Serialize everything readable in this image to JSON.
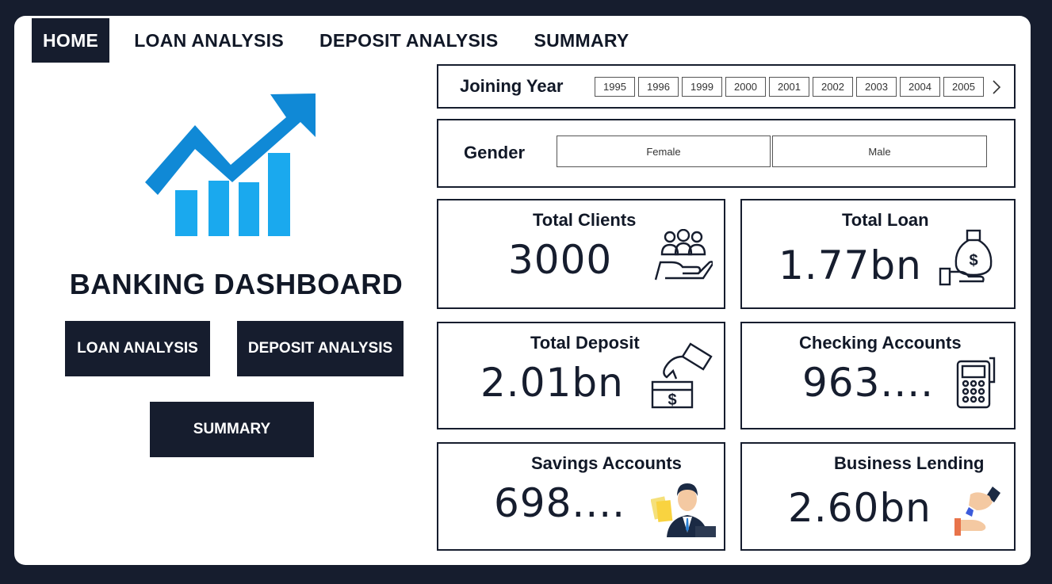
{
  "nav": {
    "items": [
      {
        "label": "HOME",
        "active": true
      },
      {
        "label": "LOAN ANALYSIS",
        "active": false
      },
      {
        "label": "DEPOSIT ANALYSIS",
        "active": false
      },
      {
        "label": "SUMMARY",
        "active": false
      }
    ]
  },
  "hero": {
    "title": "BANKING DASHBOARD",
    "buttons": {
      "loan": "LOAN ANALYSIS",
      "deposit": "DEPOSIT ANALYSIS",
      "summary": "SUMMARY"
    }
  },
  "filters": {
    "joining_year": {
      "label": "Joining Year",
      "years": [
        "1995",
        "1996",
        "1999",
        "2000",
        "2001",
        "2002",
        "2003",
        "2004",
        "2005"
      ]
    },
    "gender": {
      "label": "Gender",
      "options": [
        "Female",
        "Male"
      ]
    }
  },
  "kpis": {
    "total_clients": {
      "title": "Total Clients",
      "value": "3000",
      "icon": "people-hand-icon"
    },
    "total_loan": {
      "title": "Total Loan",
      "value": "1.77bn",
      "icon": "money-bag-hand-icon"
    },
    "total_deposit": {
      "title": "Total Deposit",
      "value": "2.01bn",
      "icon": "deposit-hand-icon"
    },
    "checking_accounts": {
      "title": "Checking Accounts",
      "value": "963....",
      "icon": "calculator-icon"
    },
    "savings_accounts": {
      "title": "Savings Accounts",
      "value": "698....",
      "icon": "banker-icon"
    },
    "business_lending": {
      "title": "Business Lending",
      "value": "2.60bn",
      "icon": "hand-lending-icon"
    }
  },
  "colors": {
    "navy": "#161d2e",
    "logo_blue": "#1089d6",
    "logo_light_blue": "#1aa9ee"
  }
}
